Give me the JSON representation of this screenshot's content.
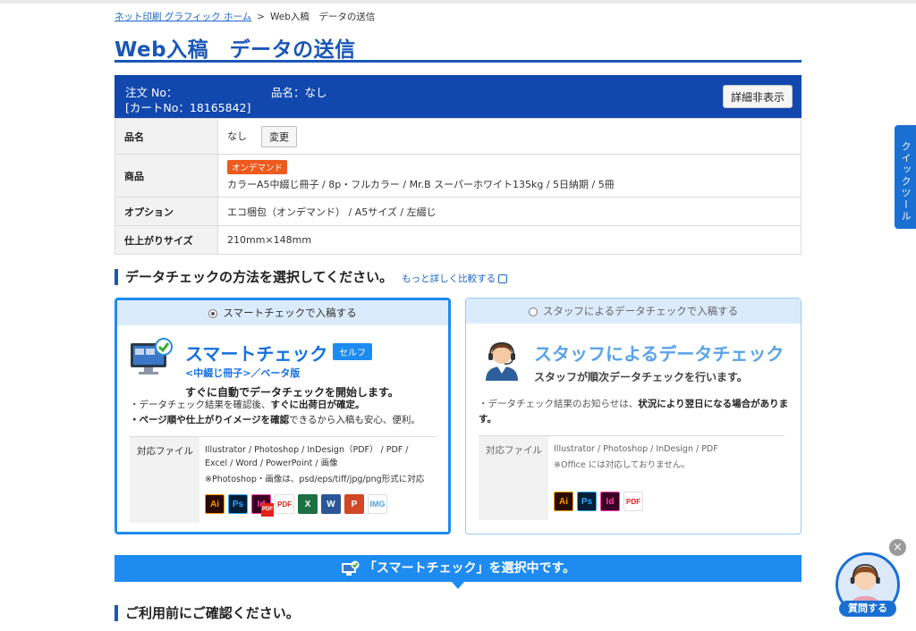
{
  "breadcrumb": {
    "home": "ネット印刷 グラフィック ホーム",
    "separator": ">",
    "current": "Web入稿　データの送信"
  },
  "page_title": "Web入稿　データの送信",
  "order": {
    "order_no_label": "注文 No：",
    "product_name_header": "品名：なし",
    "cart_no": "[カートNo：18165842]",
    "toggle_button": "詳細非表示",
    "rows": {
      "name_label": "品名",
      "name_value": "なし",
      "change_button": "変更",
      "product_label": "商品",
      "badge": "オンデマンド",
      "product_value": "カラーA5中綴じ冊子 / 8p・フルカラー / Mr.B スーパーホワイト135kg / 5日納期 / 5冊",
      "option_label": "オプション",
      "option_value": "エコ梱包（オンデマンド） / A5サイズ / 左綴じ",
      "size_label": "仕上がりサイズ",
      "size_value": "210mm×148mm"
    }
  },
  "method_section": {
    "title": "データチェックの方法を選択してください。",
    "compare_link": "もっと詳しく比較する"
  },
  "smart": {
    "radio_label": "スマートチェックで入稿する",
    "title": "スマートチェック",
    "badge": "セルフ",
    "subtitle": "<中綴じ冊子>／ベータ版",
    "lead": "すぐに自動でデータチェックを開始します。",
    "bullet1_a": "・データチェック結果を確認後、",
    "bullet1_b": "すぐに出荷日が確定。",
    "bullet2_a": "・ページ順や仕上がりイメージを確認",
    "bullet2_b": "できるから入稿も安心、便利。",
    "files_label": "対応ファイル",
    "files_line1": "Illustrator / Photoshop / InDesign（PDF） / PDF /",
    "files_line2": "Excel / Word / PowerPoint / 画像",
    "files_note": "※Photoshop・画像は、psd/eps/tiff/jpg/png形式に対応"
  },
  "staff": {
    "radio_label": "スタッフによるデータチェックで入稿する",
    "title": "スタッフによるデータチェック",
    "lead": "スタッフが順次データチェックを行います。",
    "bullet1_a": "・データチェック結果のお知らせは、",
    "bullet1_b": "状況により翌日になる場合があります。",
    "files_label": "対応ファイル",
    "files_line1": "Illustrator / Photoshop / InDesign / PDF",
    "files_note": "※Office には対応しておりません。"
  },
  "icons": {
    "ai": "Ai",
    "ps": "Ps",
    "id": "Id",
    "pdf": "PDF",
    "xls": "X",
    "doc": "W",
    "ppt": "P",
    "img": "IMG"
  },
  "selected_banner": "「スマートチェック」を選択中です。",
  "confirm_section": {
    "title": "ご利用前にご確認ください。"
  },
  "quick_tool": "クイックツール",
  "chat": {
    "label": "質問する",
    "close": "×"
  },
  "colors": {
    "brand_blue": "#1a56b8",
    "accent_blue": "#1e8bf0",
    "badge_orange": "#ee5a1c"
  }
}
